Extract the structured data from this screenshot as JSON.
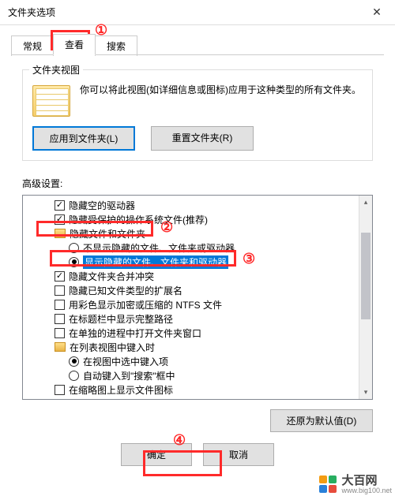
{
  "window": {
    "title": "文件夹选项"
  },
  "tabs": {
    "general": "常规",
    "view": "查看",
    "search": "搜索"
  },
  "group": {
    "legend": "文件夹视图",
    "desc": "你可以将此视图(如详细信息或图标)应用于这种类型的所有文件夹。",
    "apply_btn": "应用到文件夹(L)",
    "reset_btn": "重置文件夹(R)"
  },
  "adv": {
    "label": "高级设置:",
    "items": {
      "hide_empty_drives": "隐藏空的驱动器",
      "hide_protected_os": "隐藏受保护的操作系统文件(推荐)",
      "hidden_folder_group": "隐藏文件和文件夹",
      "dont_show_hidden": "不显示隐藏的文件、文件夹或驱动器",
      "show_hidden": "显示隐藏的文件、文件夹和驱动器",
      "hide_merge_conflict": "隐藏文件夹合并冲突",
      "hide_known_ext": "隐藏已知文件类型的扩展名",
      "colored_ntfs": "用彩色显示加密或压缩的 NTFS 文件",
      "full_path_title": "在标题栏中显示完整路径",
      "open_separate_proc": "在单独的进程中打开文件夹窗口",
      "list_type_group": "在列表视图中键入时",
      "select_in_view": "在视图中选中键入项",
      "auto_type_search": "自动键入到\"搜索\"框中",
      "thumb_cutoff": "在缩略图上显示文件图标"
    }
  },
  "buttons": {
    "restore": "还原为默认值(D)",
    "ok": "确定",
    "cancel": "取消"
  },
  "annotations": {
    "c1": "①",
    "c2": "②",
    "c3": "③",
    "c4": "④"
  },
  "watermark": {
    "cn": "大百网",
    "en": "www.big100.net"
  }
}
